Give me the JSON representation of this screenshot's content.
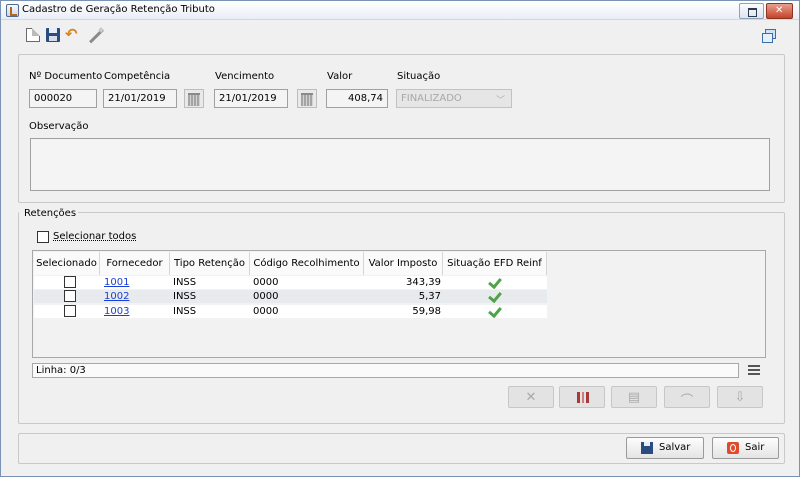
{
  "window": {
    "title": "Cadastro de Geração Retenção Tributo"
  },
  "toolbar": {
    "icons": [
      "new-document-icon",
      "save-icon",
      "undo-icon",
      "magic-wand-icon",
      "windows-icon"
    ]
  },
  "form": {
    "documento": {
      "label": "Nº Documento",
      "value": "000020"
    },
    "competencia": {
      "label": "Competência",
      "value": "21/01/2019"
    },
    "vencimento": {
      "label": "Vencimento",
      "value": "21/01/2019"
    },
    "valor": {
      "label": "Valor",
      "value": "408,74"
    },
    "situacao": {
      "label": "Situação",
      "value": "FINALIZADO"
    },
    "observacao": {
      "label": "Observação",
      "value": ""
    }
  },
  "retencoes": {
    "title": "Retenções",
    "select_all_label": "Selecionar todos",
    "columns": [
      "Selecionado",
      "Fornecedor",
      "Tipo Retenção",
      "Código Recolhimento",
      "Valor Imposto",
      "Situação EFD Reinf"
    ],
    "rows": [
      {
        "fornecedor": "1001",
        "tipo": "INSS",
        "codigo": "0000",
        "valor": "343,39",
        "status_icon": "check-icon"
      },
      {
        "fornecedor": "1002",
        "tipo": "INSS",
        "codigo": "0000",
        "valor": "5,37",
        "status_icon": "check-icon"
      },
      {
        "fornecedor": "1003",
        "tipo": "INSS",
        "codigo": "0000",
        "valor": "59,98",
        "status_icon": "check-icon"
      }
    ],
    "linha": "Linha: 0/3"
  },
  "actions": {
    "icons": [
      "delete-icon",
      "columns-icon",
      "clipboard-icon",
      "broom-icon",
      "export-icon"
    ]
  },
  "footer": {
    "save_label": "Salvar",
    "exit_label": "Sair"
  },
  "colors": {
    "link": "#1a3fd6",
    "check": "#4fa34a",
    "close_button": "#c7432a",
    "exit_icon": "#e0492c"
  }
}
